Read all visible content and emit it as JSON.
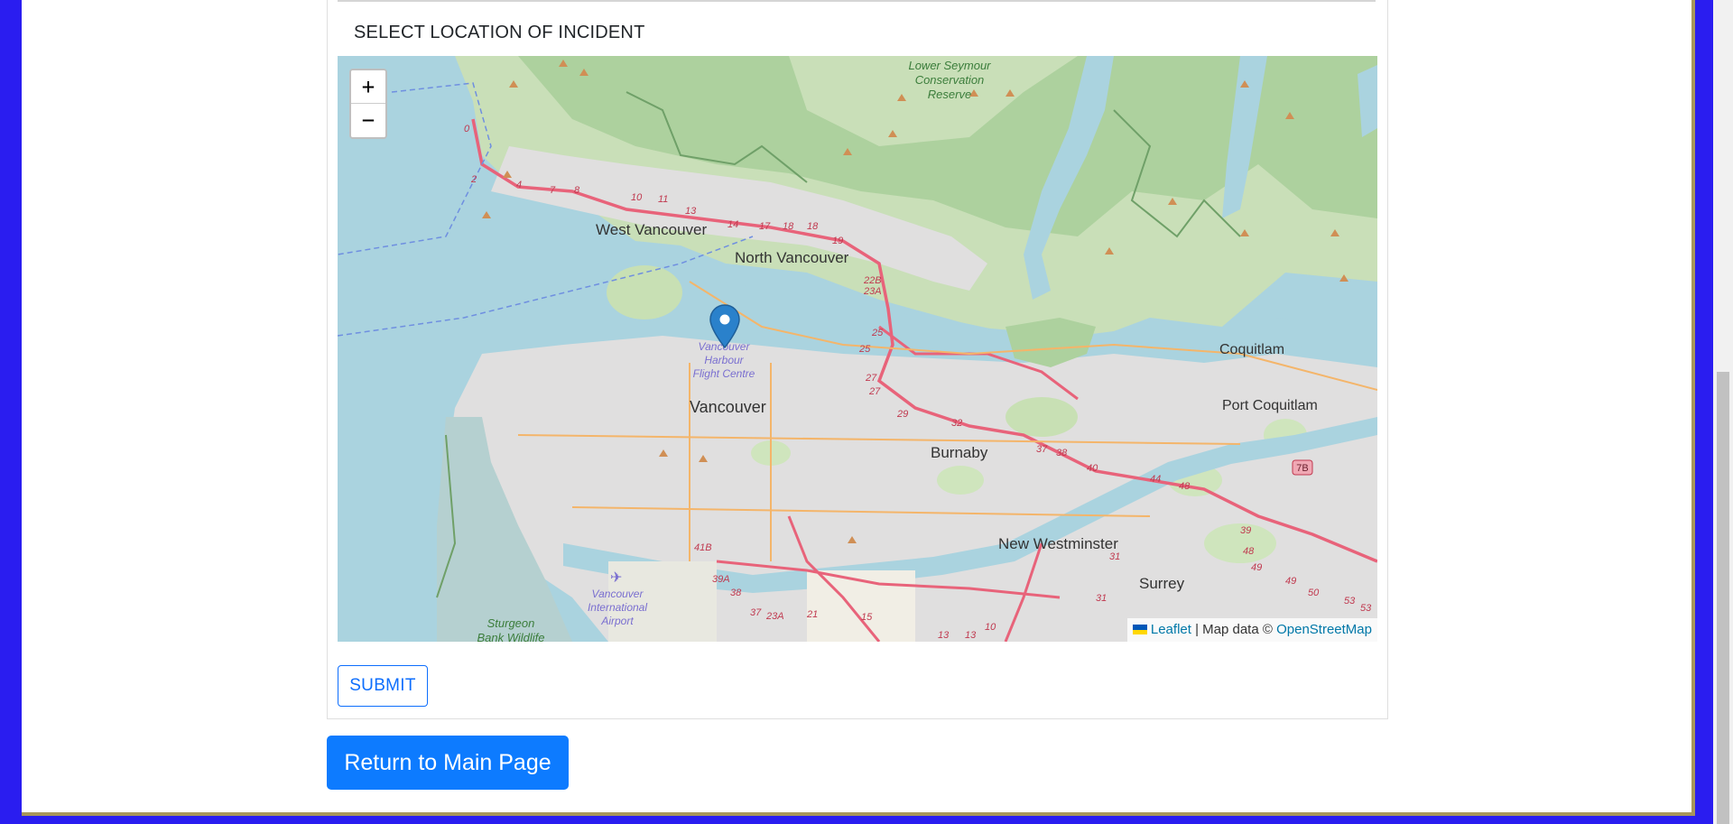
{
  "form": {
    "location_label": "SELECT LOCATION OF INCIDENT",
    "submit_label": "SUBMIT"
  },
  "map": {
    "zoom_in": "+",
    "zoom_out": "−",
    "attribution": {
      "leaflet": "Leaflet",
      "separator": " | Map data © ",
      "osm": "OpenStreetMap"
    },
    "places": {
      "west_vancouver": "West Vancouver",
      "north_vancouver": "North Vancouver",
      "vancouver": "Vancouver",
      "burnaby": "Burnaby",
      "coquitlam": "Coquitlam",
      "port_coquitlam": "Port Coquitlam",
      "new_westminster": "New Westminster",
      "surrey": "Surrey",
      "lower_seymour_1": "Lower Seymour",
      "lower_seymour_2": "Conservation",
      "lower_seymour_3": "Reserve",
      "harbour_1": "Vancouver",
      "harbour_2": "Harbour",
      "harbour_3": "Flight Centre",
      "airport_1": "Vancouver",
      "airport_2": "International",
      "airport_3": "Airport",
      "sturgeon_1": "Sturgeon",
      "sturgeon_2": "Bank Wildlife"
    },
    "route_badge": "7B"
  },
  "footer": {
    "return_label": "Return to Main Page"
  },
  "colors": {
    "accent": "#0d6efd",
    "return_button": "#0d7bff",
    "page_border": "#2a1df0",
    "water": "#aad3df",
    "forest": "#add19e",
    "urban": "#e0dfdf",
    "highway": "#e8637a",
    "marker": "#2a81cb"
  }
}
